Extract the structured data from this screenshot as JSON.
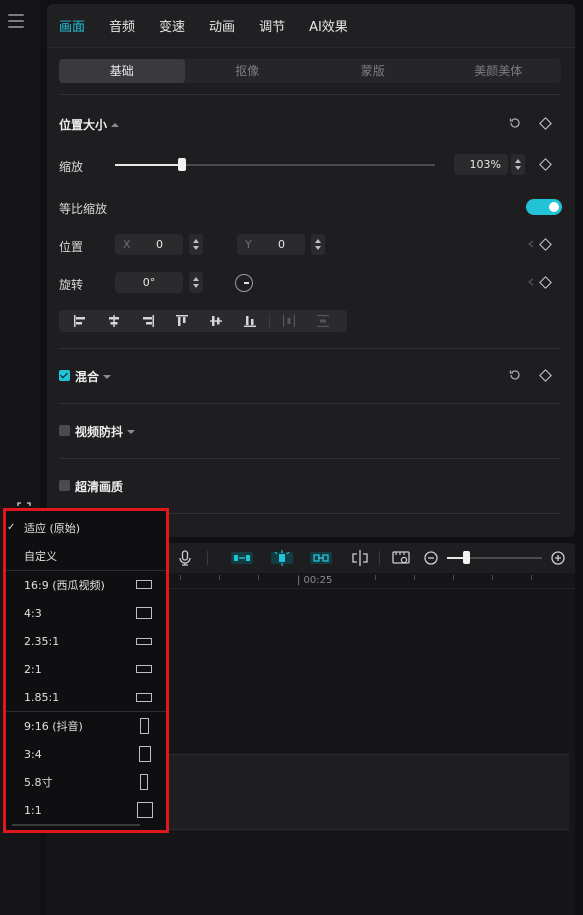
{
  "panel": {
    "tabs": [
      "画面",
      "音频",
      "变速",
      "动画",
      "调节",
      "AI效果"
    ],
    "active_tab": "画面",
    "subtabs": [
      "基础",
      "抠像",
      "蒙版",
      "美颜美体"
    ],
    "active_subtab": "基础"
  },
  "transform": {
    "section_title": "位置大小",
    "scale_label": "缩放",
    "scale_value": "103%",
    "scale_level_fraction": 0.21,
    "uniform_scale_label": "等比缩放",
    "uniform_scale_on": true,
    "position_label": "位置",
    "x_axis": "X",
    "x_value": "0",
    "y_axis": "Y",
    "y_value": "0",
    "rotation_label": "旋转",
    "rotation_value": "0°"
  },
  "sections": {
    "blend": "混合",
    "blend_checked": true,
    "stabilize": "视频防抖",
    "stabilize_checked": false,
    "hd": "超清画质",
    "hd_checked": false
  },
  "timeline": {
    "ruler_label": "| 00:25"
  },
  "ratio_menu": {
    "selected": "适应 (原始)",
    "items": [
      {
        "label": "适应 (原始)",
        "checked": true
      },
      {
        "label": "自定义"
      },
      {
        "label": "16:9 (西瓜视频)"
      },
      {
        "label": "4:3"
      },
      {
        "label": "2.35:1"
      },
      {
        "label": "2:1"
      },
      {
        "label": "1.85:1"
      },
      {
        "label": "9:16 (抖音)"
      },
      {
        "label": "3:4"
      },
      {
        "label": "5.8寸"
      },
      {
        "label": "1:1"
      }
    ]
  },
  "colors": {
    "accent": "#22c3d6",
    "highlight_border": "#e0181e",
    "panel_bg": "#1e1e21"
  }
}
